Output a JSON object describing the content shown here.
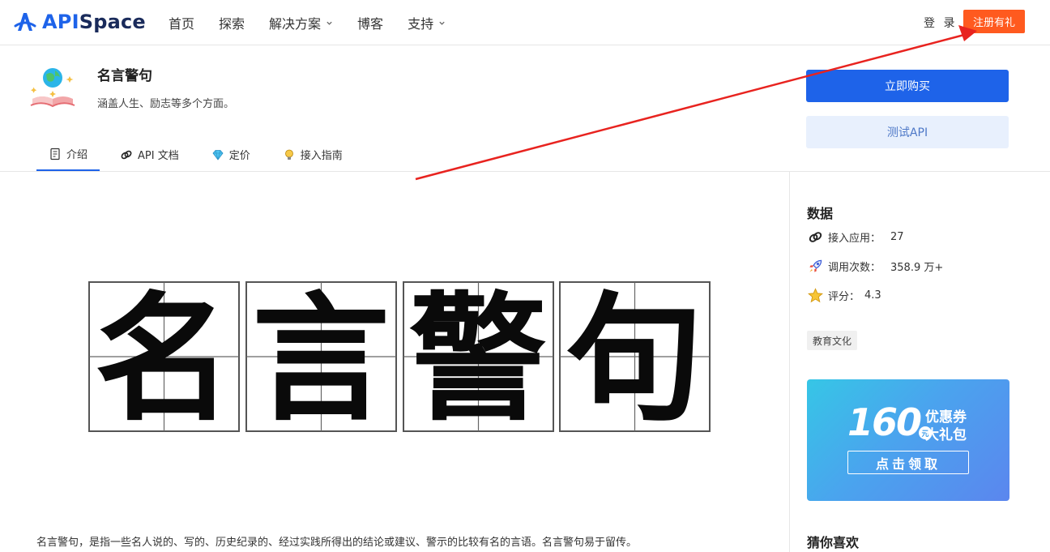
{
  "logo": {
    "prefix": "API",
    "suffix": "Space"
  },
  "nav": {
    "items": [
      {
        "label": "首页"
      },
      {
        "label": "探索"
      },
      {
        "label": "解决方案"
      },
      {
        "label": "博客"
      },
      {
        "label": "支持"
      }
    ],
    "login_label": "登 录",
    "register_label": "注册有礼"
  },
  "product": {
    "title": "名言警句",
    "subtitle": "涵盖人生、励志等多个方面。",
    "buy_label": "立即购买",
    "test_label": "测试API",
    "tabs": [
      {
        "label": "介绍"
      },
      {
        "label": "API 文档"
      },
      {
        "label": "定价"
      },
      {
        "label": "接入指南"
      }
    ]
  },
  "main": {
    "calligraphy_chars": [
      "名",
      "言",
      "警",
      "句"
    ],
    "description": "名言警句，是指一些名人说的、写的、历史纪录的、经过实践所得出的结论或建议、警示的比较有名的言语。名言警句易于留传。"
  },
  "sidebar": {
    "data_title": "数据",
    "stats": [
      {
        "label": "接入应用：",
        "value": "27"
      },
      {
        "label": "调用次数：",
        "value": "358.9 万+"
      },
      {
        "label": "评分：",
        "value": "4.3"
      }
    ],
    "tag": "教育文化",
    "promo": {
      "amount": "160",
      "unit": "元",
      "line1": "优惠券",
      "line2": "大礼包",
      "claim": "点击领取"
    },
    "recommend_title": "猜你喜欢"
  },
  "colors": {
    "brand": "#1e63e9",
    "register": "#ff5a1f",
    "arrow": "#e8231f"
  }
}
